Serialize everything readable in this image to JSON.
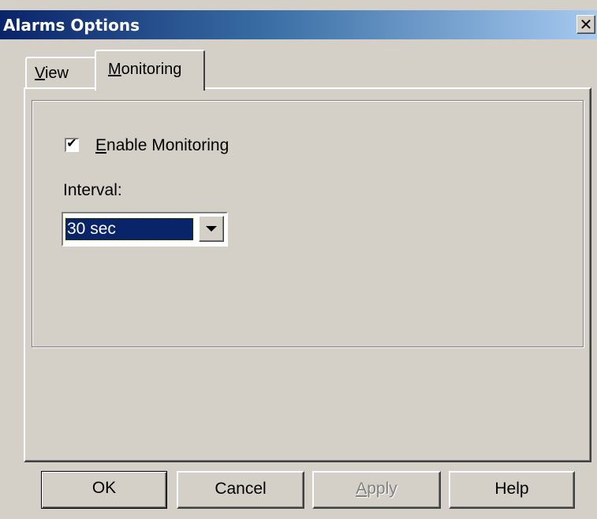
{
  "window": {
    "title": "Alarms Options",
    "close_icon": "close-x-icon"
  },
  "tabs": [
    {
      "label_prefix": "",
      "label_mnemonic": "V",
      "label_rest": "iew",
      "selected": false
    },
    {
      "label_prefix": "",
      "label_mnemonic": "M",
      "label_rest": "onitoring",
      "selected": true
    }
  ],
  "monitoring": {
    "enable_checkbox": {
      "checked": true,
      "check_glyph": "✔",
      "label_mnemonic": "E",
      "label_rest": "nable Monitoring"
    },
    "interval_label": "Interval:",
    "interval_value": "30 sec"
  },
  "buttons": {
    "ok": "OK",
    "cancel": "Cancel",
    "apply_mnemonic": "A",
    "apply_rest": "pply",
    "help": "Help"
  },
  "colors": {
    "title_gradient_start": "#0a246a",
    "title_gradient_end": "#a6caf0",
    "dialog_face": "#d4d0c8",
    "selection": "#0a246a"
  }
}
